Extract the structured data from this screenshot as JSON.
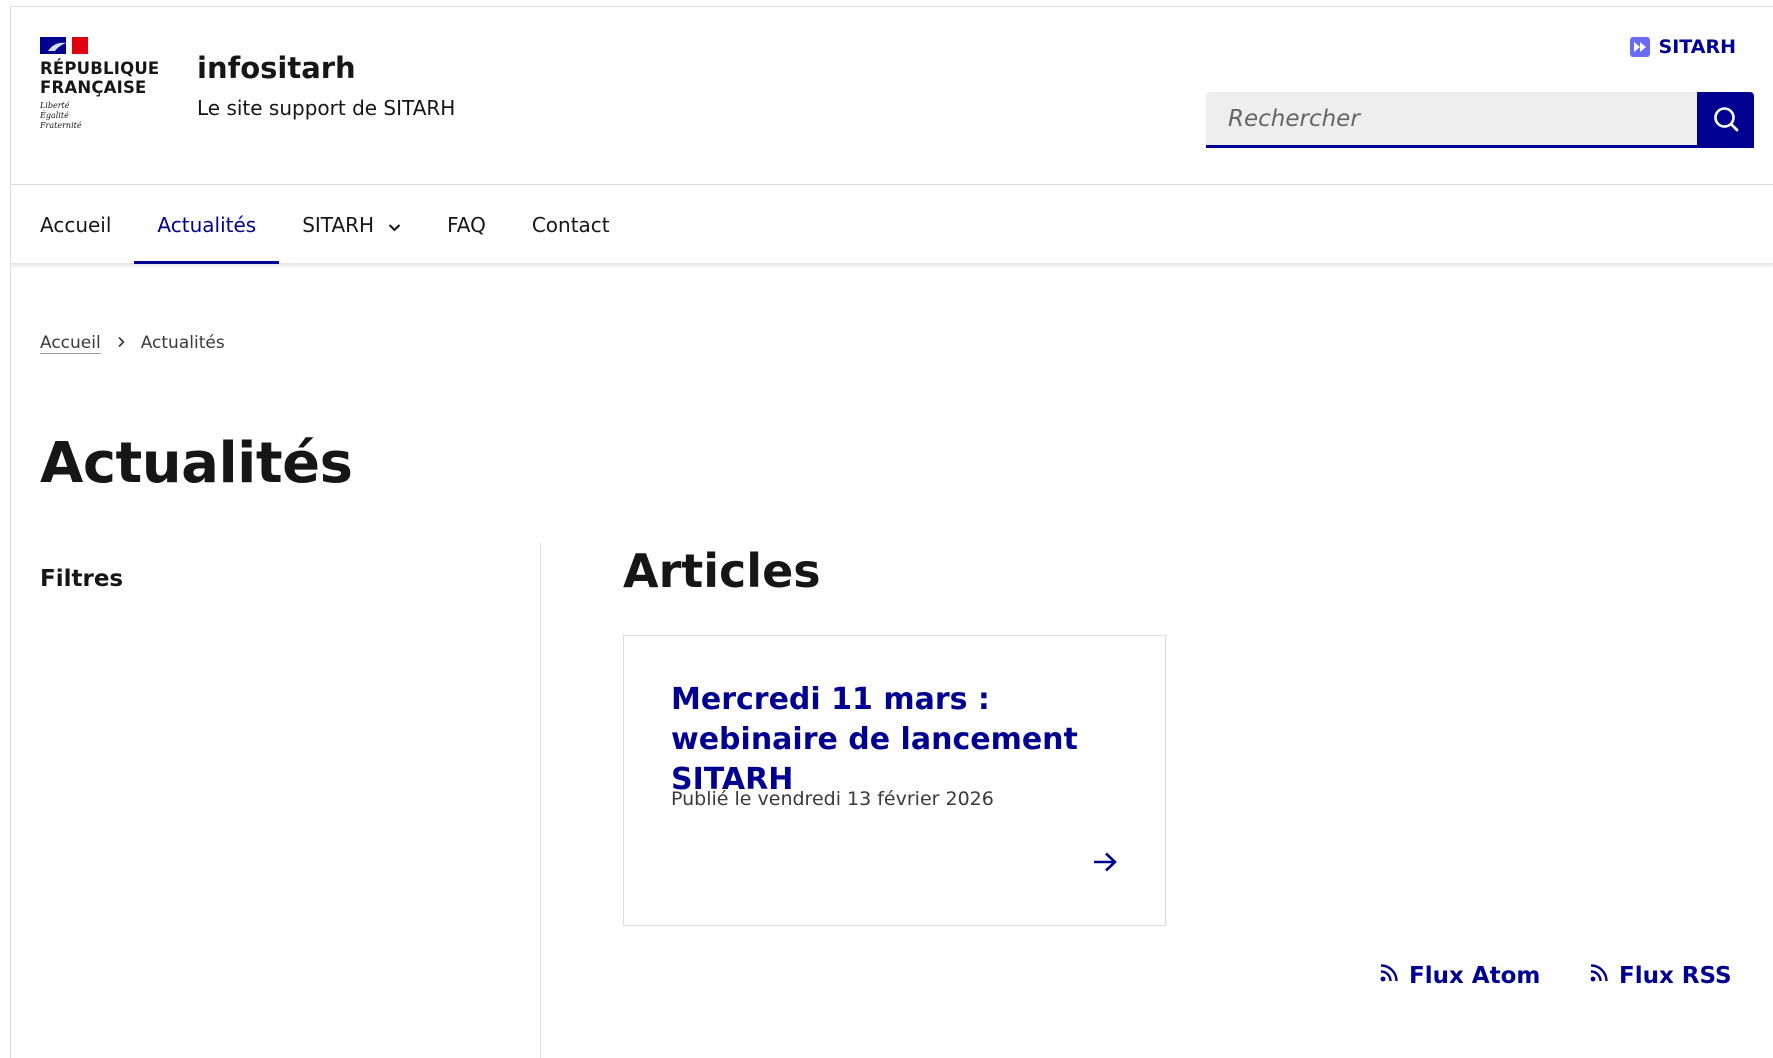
{
  "logo": {
    "republique": [
      "RÉPUBLIQUE",
      "FRANÇAISE"
    ],
    "devise": [
      "Liberté",
      "Égalité",
      "Fraternité"
    ]
  },
  "site": {
    "title": "infositarh",
    "tagline": "Le site support de SITARH"
  },
  "header": {
    "quick_link": "SITARH",
    "quick_link_icon": "fast-forward-icon"
  },
  "search": {
    "placeholder": "Rechercher",
    "value": "",
    "icon": "search-icon"
  },
  "nav": {
    "items": [
      {
        "label": "Accueil",
        "active": false
      },
      {
        "label": "Actualités",
        "active": true
      },
      {
        "label": "SITARH",
        "active": false,
        "has_dropdown": true
      },
      {
        "label": "FAQ",
        "active": false
      },
      {
        "label": "Contact",
        "active": false
      }
    ]
  },
  "breadcrumb": {
    "home": "Accueil",
    "current": "Actualités"
  },
  "page": {
    "title": "Actualités"
  },
  "sidebar": {
    "filters_title": "Filtres"
  },
  "articles": {
    "title": "Articles",
    "items": [
      {
        "title": "Mercredi 11 mars : webinaire de lancement SITARH",
        "date": "Publié le vendredi 13 février 2026"
      }
    ]
  },
  "feeds": {
    "atom": "Flux Atom",
    "rss": "Flux RSS"
  },
  "colors": {
    "primary": "#000091",
    "flag_blue": "#000091",
    "flag_red": "#e1000f",
    "text": "#161616",
    "border": "#dddddd",
    "search_bg": "#eeeeee"
  }
}
